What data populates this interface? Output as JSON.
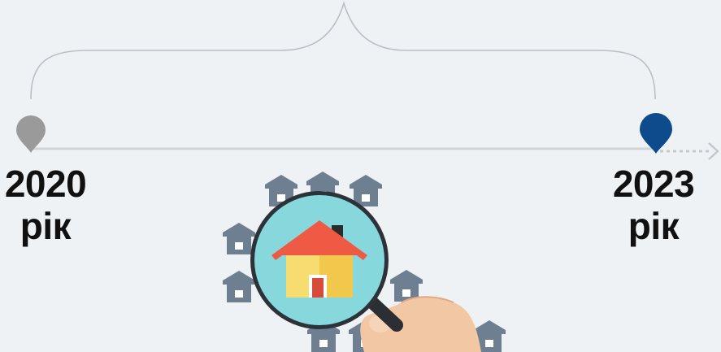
{
  "timeline": {
    "start": {
      "year": "2020",
      "unit": "рік",
      "marker_color": "#9a9a9a"
    },
    "end": {
      "year": "2023",
      "unit": "рік",
      "marker_color": "#0d4b8c"
    }
  },
  "colors": {
    "background": "#eef2f5",
    "timeline_line": "#cfd4d8",
    "brace": "#b9c0c5",
    "house_icon": "#6e7f91",
    "lens": "#86d8dc",
    "roof": "#ef5a45",
    "wall": "#f7dc6f",
    "door": "#d84a3a"
  },
  "illustration": {
    "center_icon": "house-magnifier-icon",
    "surrounding_icon": "small-house-icon"
  }
}
